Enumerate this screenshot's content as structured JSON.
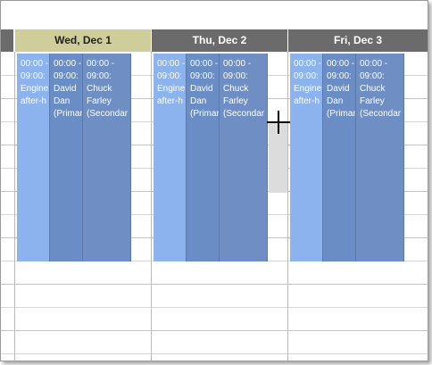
{
  "columns": [
    {
      "header": "Wed, Dec 1",
      "events": [
        {
          "time_start": "00:00 -",
          "time_end": "09:00:",
          "title": "Engine",
          "detail": "after-h"
        },
        {
          "time_start": "00:00 -",
          "time_end": "09:00:",
          "title": "David",
          "detail": "Dan",
          "extra": "(Primar"
        },
        {
          "time_start": "00:00 -",
          "time_end": "09:00:",
          "title": "Chuck",
          "detail": "Farley",
          "extra": "(Secondar"
        }
      ]
    },
    {
      "header": "Thu, Dec 2",
      "events": [
        {
          "time_start": "00:00 -",
          "time_end": "09:00:",
          "title": "Engine",
          "detail": "after-h"
        },
        {
          "time_start": "00:00 -",
          "time_end": "09:00:",
          "title": "David",
          "detail": "Dan",
          "extra": "(Primar"
        },
        {
          "time_start": "00:00 -",
          "time_end": "09:00:",
          "title": "Chuck",
          "detail": "Farley",
          "extra": "(Secondar"
        }
      ]
    },
    {
      "header": "Fri, Dec 3",
      "events": [
        {
          "time_start": "00:00 -",
          "time_end": "09:00:",
          "title": "Engine",
          "detail": "after-h"
        },
        {
          "time_start": "00:00 -",
          "time_end": "09:00:",
          "title": "David",
          "detail": "Dan",
          "extra": "(Primar"
        },
        {
          "time_start": "00:00 -",
          "time_end": "09:00:",
          "title": "Chuck",
          "detail": "Farley",
          "extra": "(Secondar"
        }
      ]
    }
  ],
  "colors": {
    "today_header": "#cfcd9a",
    "day_header": "#6b6b6b",
    "event_light": "#8cb3ee",
    "event_dark": "#6a8dc6"
  }
}
